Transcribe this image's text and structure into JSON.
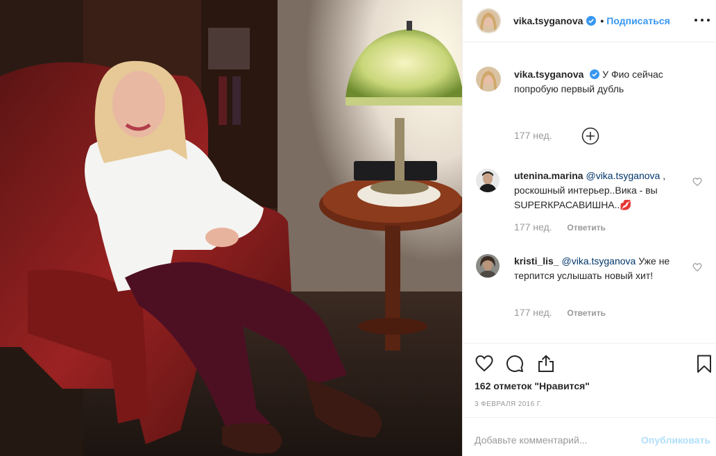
{
  "header": {
    "username": "vika.tsyganova",
    "separator": "•",
    "follow_label": "Подписаться"
  },
  "caption": {
    "username": "vika.tsyganova",
    "text": "У Фио сейчас попробую первый дубль",
    "time": "177 нед."
  },
  "comments": [
    {
      "username": "utenina.marina",
      "mention": "@vika.tsyganova",
      "text": ", роскошный интерьер..Вика - вы SUPERКРАСАВИШНА..💋",
      "time": "177 нед.",
      "reply_label": "Ответить"
    },
    {
      "username": "kristi_lis_",
      "mention": "@vika.tsyganova",
      "text": "Уже не терпится услышать новый хит!",
      "time": "177 нед.",
      "reply_label": "Ответить"
    }
  ],
  "actions": {
    "icons": [
      "heart-icon",
      "comment-icon",
      "share-icon",
      "bookmark-icon"
    ],
    "likes_text": "162 отметок \"Нравится\"",
    "date": "3 ФЕВРАЛЯ 2016 Г."
  },
  "add_comment": {
    "placeholder": "Добавьте комментарий...",
    "publish_label": "Опубликовать"
  },
  "colors": {
    "link": "#3897f0",
    "verified": "#3897f0",
    "muted": "#999999",
    "publish_disabled": "#b2dffc"
  }
}
